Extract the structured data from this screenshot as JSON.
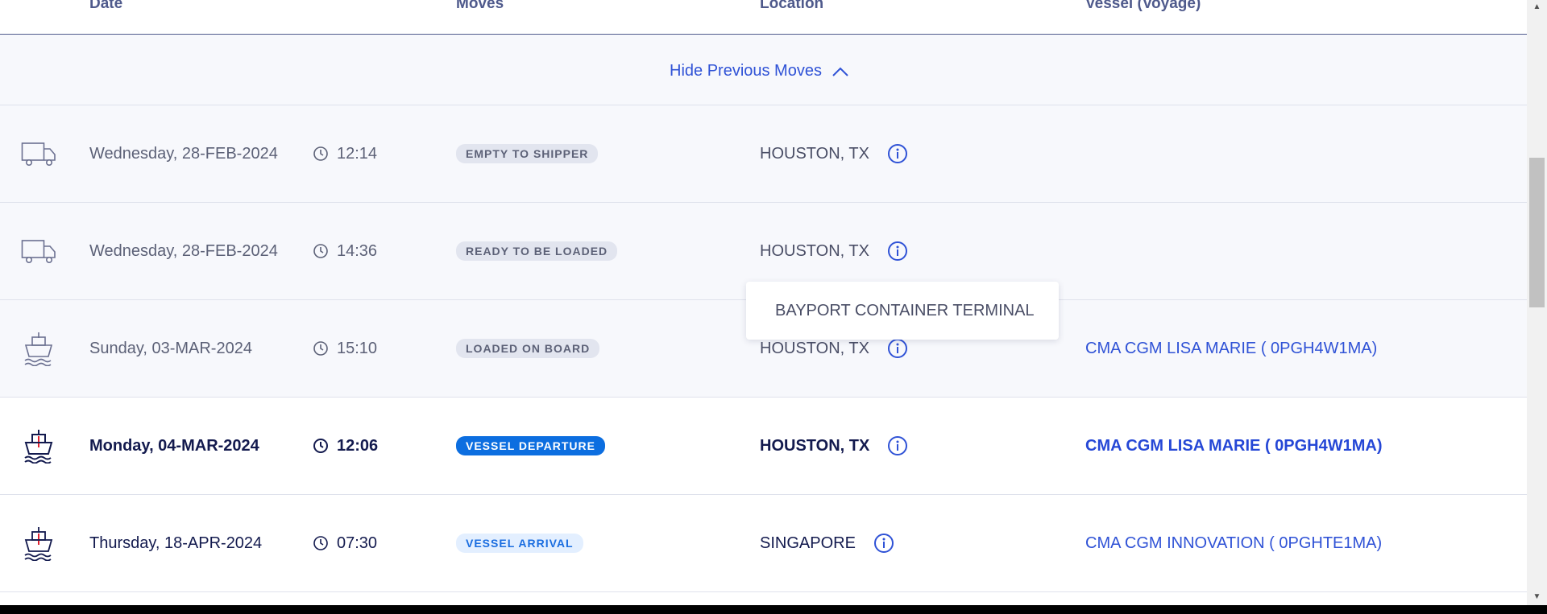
{
  "table": {
    "headers": {
      "date": "Date",
      "moves": "Moves",
      "location": "Location",
      "vessel": "Vessel (Voyage)"
    },
    "hide_previous_label": "Hide Previous Moves",
    "rows": [
      {
        "transport_icon": "truck-icon",
        "date": "Wednesday, 28-FEB-2024",
        "time": "12:14",
        "move": "EMPTY TO SHIPPER",
        "location": "HOUSTON, TX",
        "vessel": ""
      },
      {
        "transport_icon": "truck-icon",
        "date": "Wednesday, 28-FEB-2024",
        "time": "14:36",
        "move": "READY TO BE LOADED",
        "location": "HOUSTON, TX",
        "vessel": ""
      },
      {
        "transport_icon": "ship-icon",
        "date": "Sunday, 03-MAR-2024",
        "time": "15:10",
        "move": "LOADED ON BOARD",
        "location": "HOUSTON, TX",
        "vessel": "CMA CGM LISA MARIE ( 0PGH4W1MA)"
      },
      {
        "transport_icon": "ship-icon",
        "date": "Monday, 04-MAR-2024",
        "time": "12:06",
        "move": "VESSEL DEPARTURE",
        "location": "HOUSTON, TX",
        "vessel": "CMA CGM LISA MARIE ( 0PGH4W1MA)"
      },
      {
        "transport_icon": "ship-icon",
        "date": "Thursday, 18-APR-2024",
        "time": "07:30",
        "move": "VESSEL ARRIVAL",
        "location": "SINGAPORE",
        "vessel": "CMA CGM INNOVATION ( 0PGHTE1MA)"
      }
    ]
  },
  "tooltip": {
    "text": "BAYPORT CONTAINER TERMINAL"
  },
  "colors": {
    "link": "#2f52d6",
    "current_badge": "#0c6ee0",
    "past_row_bg": "#f7f8fc",
    "header_text": "#4f5a8c",
    "ship_accent_red": "#e0202e"
  },
  "icons": {
    "hide_toggle": "chevron-up-icon",
    "time": "clock-icon",
    "location_info": "info-icon"
  }
}
